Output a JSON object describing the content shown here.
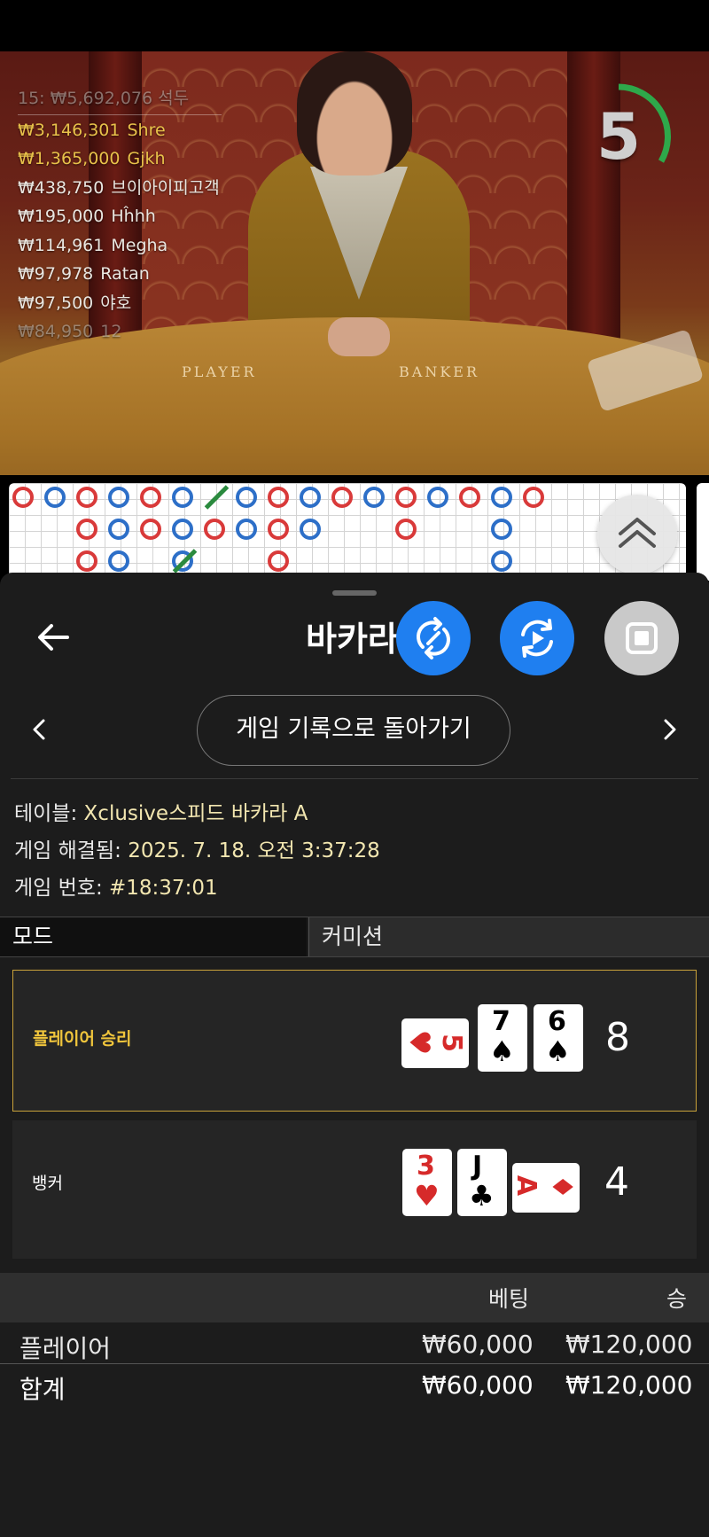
{
  "leaderboard": {
    "header_amount": "₩5,692,076",
    "header_prefix": "15:",
    "header_name": "석두",
    "rows": [
      {
        "amount": "₩3,146,301",
        "name": "Shre",
        "style": "gold"
      },
      {
        "amount": "₩1,365,000",
        "name": "Gjkh",
        "style": "gold"
      },
      {
        "amount": "₩438,750",
        "name": "브이아이피고객",
        "style": "light"
      },
      {
        "amount": "₩195,000",
        "name": "Hĥhh",
        "style": "light"
      },
      {
        "amount": "₩114,961",
        "name": "Megha",
        "style": "light"
      },
      {
        "amount": "₩97,978",
        "name": "Ratan",
        "style": "light"
      },
      {
        "amount": "₩97,500",
        "name": "야호",
        "style": "light"
      },
      {
        "amount": "₩84,950",
        "name": "12",
        "style": "dim"
      }
    ]
  },
  "table_felt": {
    "player": "PLAYER",
    "banker": "BANKER"
  },
  "timer": {
    "value": "5",
    "color": "#2ea84a"
  },
  "bead_road": {
    "colors": {
      "player": "#2d6fc8",
      "banker": "#d93a3a",
      "tie": "#2a8a3e"
    }
  },
  "sheet": {
    "title": "바카라",
    "history_button": "게임 기록으로 돌아가기",
    "table_label": "테이블:",
    "table_value": "Xclusive스피드 바카라 A",
    "resolved_label": "게임 해결됨:",
    "resolved_value": "2025. 7. 18. 오전 3:37:28",
    "number_label": "게임 번호:",
    "number_value": "#18:37:01",
    "tabs": [
      "모드",
      "커미션"
    ]
  },
  "results": {
    "player": {
      "label": "플레이어 승리",
      "score": "8",
      "cards": [
        {
          "rank": "5",
          "suit": "♥",
          "color": "red",
          "orientation": "sideways"
        },
        {
          "rank": "7",
          "suit": "♠",
          "color": "black",
          "orientation": "upright"
        },
        {
          "rank": "6",
          "suit": "♠",
          "color": "black",
          "orientation": "upright"
        }
      ]
    },
    "banker": {
      "label": "뱅커",
      "score": "4",
      "cards": [
        {
          "rank": "3",
          "suit": "♥",
          "color": "red",
          "orientation": "upright"
        },
        {
          "rank": "J",
          "suit": "♣",
          "color": "black",
          "orientation": "upright"
        },
        {
          "rank": "A",
          "suit": "♦",
          "color": "red",
          "orientation": "sideways"
        }
      ]
    }
  },
  "bets": {
    "headers": {
      "bet": "베팅",
      "win": "승"
    },
    "rows": [
      {
        "name": "플레이어",
        "bet": "₩60,000",
        "win": "₩120,000"
      }
    ],
    "total": {
      "name": "합계",
      "bet": "₩60,000",
      "win": "₩120,000"
    }
  },
  "colors": {
    "accent_blue": "#1f7ff0",
    "win_gold": "#f0c53c",
    "value_text": "#f2e6b0"
  }
}
